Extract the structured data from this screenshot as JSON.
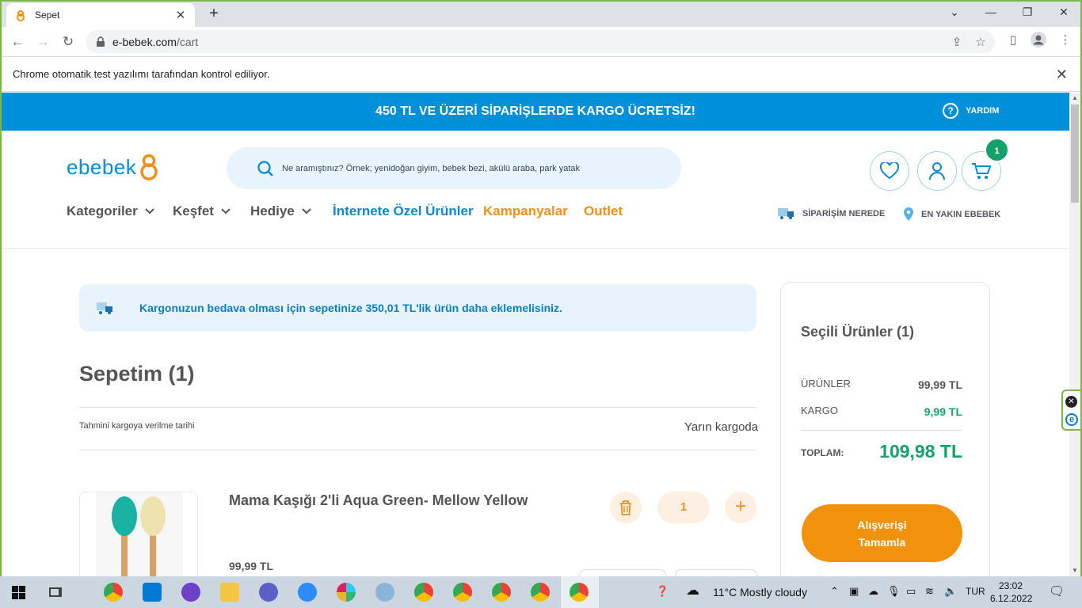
{
  "browser": {
    "tab_title": "Sepet",
    "url_host": "e-bebek.com",
    "url_path": "/cart",
    "infobar_text": "Chrome otomatik test yazılımı tarafından kontrol ediliyor."
  },
  "site": {
    "promo_banner": "450 TL VE ÜZERİ SİPARİŞLERDE KARGO ÜCRETSİZ!",
    "help_label": "YARDIM",
    "logo_text": "ebebek",
    "search_placeholder": "Ne aramıştınız? Örnek; yenidoğan giyim, bebek bezi, akülü araba, park yatak",
    "cart_count": "1",
    "nav": [
      {
        "label": "Kategoriler",
        "dropdown": true
      },
      {
        "label": "Keşfet",
        "dropdown": true
      },
      {
        "label": "Hediye",
        "dropdown": true
      },
      {
        "label": "İnternete Özel Ürünler",
        "color": "#0a89d0"
      },
      {
        "label": "Kampanyalar",
        "color": "#f28e1c"
      },
      {
        "label": "Outlet",
        "color": "#f28e1c"
      }
    ],
    "quick_links": {
      "order_tracking": "SİPARİŞİM NEREDE",
      "nearest_store": "EN YAKIN EBEBEK"
    }
  },
  "cart": {
    "free_shipping_notice": "Kargonuzun bedava olması için sepetinize 350,01 TL'lik ürün daha eklemelisiniz.",
    "title": "Sepetim (1)",
    "shipping_date_label": "Tahmini kargoya verilme tarihi",
    "shipping_date_value": "Yarın kargoda",
    "items": [
      {
        "name": "Mama Kaşığı 2'li Aqua Green- Mellow Yellow",
        "price": "99,99 TL",
        "quantity": "1"
      }
    ]
  },
  "summary": {
    "title": "Seçili Ürünler (1)",
    "products_label": "ÜRÜNLER",
    "products_value": "99,99 TL",
    "shipping_label": "KARGO",
    "shipping_value": "9,99 TL",
    "total_label": "TOPLAM:",
    "total_value": "109,98 TL",
    "checkout_line1": "Alışverişi",
    "checkout_line2": "Tamamla"
  },
  "taskbar": {
    "weather": "11°C  Mostly cloudy",
    "language": "TUR",
    "time": "23:02",
    "date": "6.12.2022"
  },
  "colors": {
    "brand_blue": "#0090d9",
    "brand_orange": "#f2910c",
    "success_green": "#13a36a",
    "window_border": "#7ab648"
  }
}
